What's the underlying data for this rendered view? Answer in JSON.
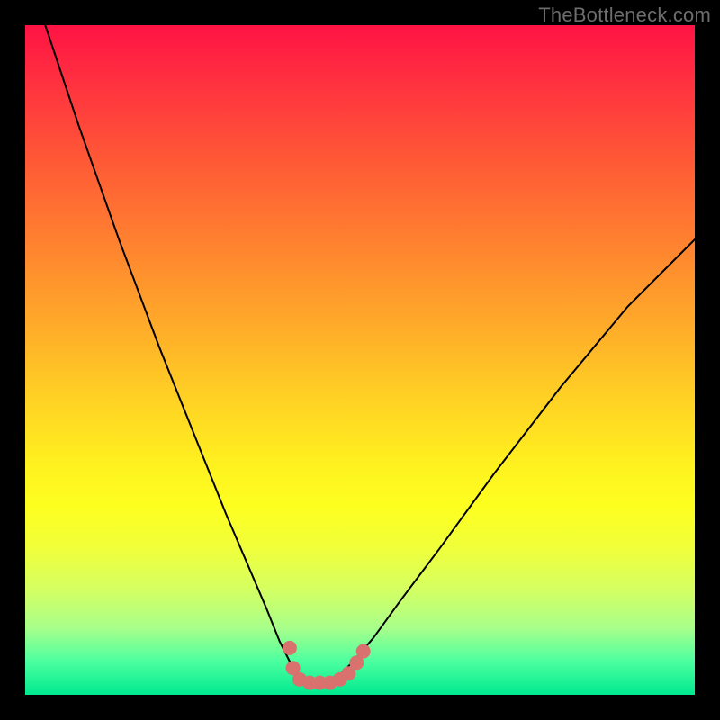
{
  "watermark": "TheBottleneck.com",
  "chart_data": {
    "type": "line",
    "title": "",
    "xlabel": "",
    "ylabel": "",
    "xlim": [
      0,
      100
    ],
    "ylim": [
      0,
      100
    ],
    "series": [
      {
        "name": "bottleneck-curve",
        "x": [
          3,
          8,
          14,
          20,
          26,
          30,
          33,
          36,
          38,
          39.5,
          41,
          42,
          43.5,
          45,
          47,
          49,
          52,
          56,
          62,
          70,
          80,
          90,
          100
        ],
        "y": [
          100,
          85,
          68,
          52,
          37,
          27,
          20,
          13,
          8,
          5,
          3,
          2,
          2,
          2.2,
          3,
          5,
          8.5,
          14,
          22,
          33,
          46,
          58,
          68
        ],
        "stroke": "#000000",
        "stroke_width": 2
      }
    ],
    "markers": {
      "name": "highlight-markers",
      "color": "#d9716e",
      "radius": 8,
      "points": [
        {
          "x": 39.5,
          "y": 7
        },
        {
          "x": 40,
          "y": 4
        },
        {
          "x": 41,
          "y": 2.3
        },
        {
          "x": 42.5,
          "y": 1.8
        },
        {
          "x": 44,
          "y": 1.8
        },
        {
          "x": 45.5,
          "y": 1.8
        },
        {
          "x": 47,
          "y": 2.3
        },
        {
          "x": 48.3,
          "y": 3.2
        },
        {
          "x": 49.5,
          "y": 4.8
        },
        {
          "x": 50.5,
          "y": 6.5
        }
      ]
    },
    "background_gradient": {
      "type": "vertical",
      "stops": [
        {
          "pos": 0,
          "color": "#ff1344"
        },
        {
          "pos": 8,
          "color": "#ff2f40"
        },
        {
          "pos": 20,
          "color": "#ff5836"
        },
        {
          "pos": 32,
          "color": "#ff8030"
        },
        {
          "pos": 44,
          "color": "#ffa82a"
        },
        {
          "pos": 56,
          "color": "#ffd224"
        },
        {
          "pos": 66,
          "color": "#fff21f"
        },
        {
          "pos": 72,
          "color": "#fdff20"
        },
        {
          "pos": 78,
          "color": "#f0ff3a"
        },
        {
          "pos": 84,
          "color": "#d6ff60"
        },
        {
          "pos": 90,
          "color": "#a8ff8a"
        },
        {
          "pos": 95,
          "color": "#4cffa0"
        },
        {
          "pos": 100,
          "color": "#00e98f"
        }
      ]
    }
  }
}
